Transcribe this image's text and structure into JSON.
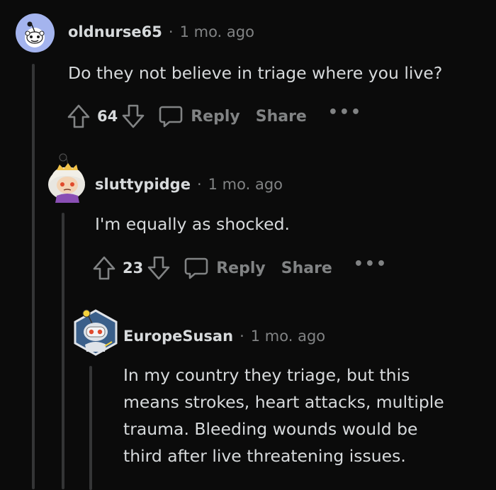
{
  "comments": [
    {
      "username": "oldnurse65",
      "time": "1 mo. ago",
      "body": [
        "Do they not believe in triage where you live?"
      ],
      "score": "64",
      "reply_label": "Reply",
      "share_label": "Share",
      "more_label": "•••",
      "avatar_icon": "default-snoo-avatar-icon"
    },
    {
      "username": "sluttypidge",
      "time": "1 mo. ago",
      "body": [
        "I'm equally as shocked."
      ],
      "score": "23",
      "reply_label": "Reply",
      "share_label": "Share",
      "more_label": "•••",
      "avatar_icon": "custom-snoo-avatar-icon"
    },
    {
      "username": "EuropeSusan",
      "time": "1 mo. ago",
      "body": [
        "In my country they triage, but this",
        "means strokes, heart attacks, multiple",
        "trauma. Bleeding wounds would be",
        "third after live threatening issues."
      ],
      "avatar_icon": "robot-snoo-avatar-icon"
    }
  ],
  "separator": "·",
  "colors": {
    "background": "#0b0b0b",
    "text": "#d7dadc",
    "muted": "#818384",
    "thread_line": "#343536",
    "avatar_blue": "#a4b4ee"
  }
}
